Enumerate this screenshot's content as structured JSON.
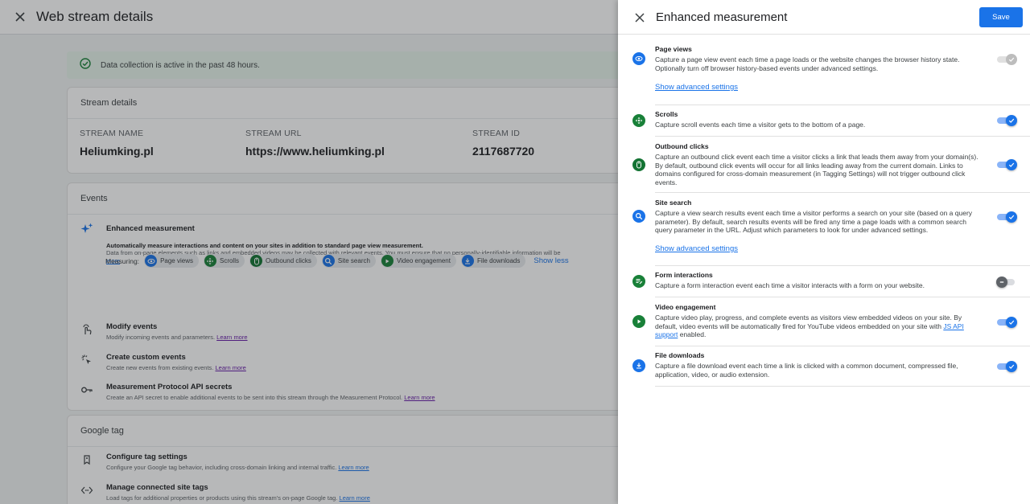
{
  "background": {
    "title": "Web stream details",
    "banner": "Data collection is active in the past 48 hours.",
    "stream_details": {
      "heading": "Stream details",
      "name_label": "STREAM NAME",
      "name_value": "Heliumking.pl",
      "url_label": "STREAM URL",
      "url_value": "https://www.heliumking.pl",
      "id_label": "STREAM ID",
      "id_value": "2117687720"
    },
    "events": {
      "heading": "Events",
      "enhanced_title": "Enhanced measurement",
      "enhanced_desc_1": "Automatically measure interactions and content on your sites in addition to standard page view measurement.",
      "enhanced_desc_2": "Data from on-page elements such as links and embedded videos may be collected with relevant events. You must ensure that no personally-identifiable information will be",
      "enhanced_more": "more",
      "measuring_label": "Measuring:",
      "chips": [
        "Page views",
        "Scrolls",
        "Outbound clicks",
        "Site search",
        "Video engagement",
        "File downloads"
      ],
      "show_less": "Show less",
      "items": [
        {
          "title": "Modify events",
          "desc": "Modify incoming events and parameters.",
          "link": "Learn more"
        },
        {
          "title": "Create custom events",
          "desc": "Create new events from existing events.",
          "link": "Learn more"
        },
        {
          "title": "Measurement Protocol API secrets",
          "desc": "Create an API secret to enable additional events to be sent into this stream through the Measurement Protocol.",
          "link": "Learn more"
        }
      ]
    },
    "google_tag": {
      "heading": "Google tag",
      "items": [
        {
          "title": "Configure tag settings",
          "desc": "Configure your Google tag behavior, including cross-domain linking and internal traffic.",
          "link": "Learn more"
        },
        {
          "title": "Manage connected site tags",
          "desc": "Load tags for additional properties or products using this stream's on-page Google tag.",
          "link": "Learn more"
        }
      ]
    }
  },
  "panel": {
    "title": "Enhanced measurement",
    "save_label": "Save",
    "settings": [
      {
        "title": "Page views",
        "desc": "Capture a page view event each time a page loads or the website changes the browser history state. Optionally turn off browser history-based events under advanced settings.",
        "advanced": "Show advanced settings",
        "state": "disabled-on",
        "icon": "eye-icon"
      },
      {
        "title": "Scrolls",
        "desc": "Capture scroll events each time a visitor gets to the bottom of a page.",
        "state": "on",
        "icon": "scroll-icon"
      },
      {
        "title": "Outbound clicks",
        "desc": "Capture an outbound click event each time a visitor clicks a link that leads them away from your domain(s). By default, outbound click events will occur for all links leading away from the current domain. Links to domains configured for cross-domain measurement (in Tagging Settings) will not trigger outbound click events.",
        "state": "on",
        "icon": "mouse-icon"
      },
      {
        "title": "Site search",
        "desc": "Capture a view search results event each time a visitor performs a search on your site (based on a query parameter). By default, search results events will be fired any time a page loads with a common search query parameter in the URL. Adjust which parameters to look for under advanced settings.",
        "advanced": "Show advanced settings",
        "state": "on",
        "icon": "search-icon"
      },
      {
        "title": "Form interactions",
        "desc": "Capture a form interaction event each time a visitor interacts with a form on your website.",
        "state": "off",
        "icon": "form-icon"
      },
      {
        "title": "Video engagement",
        "desc_before": "Capture video play, progress, and complete events as visitors view embedded videos on your site. By default, video events will be automatically fired for YouTube videos embedded on your site with ",
        "desc_link": "JS API support",
        "desc_after": " enabled.",
        "state": "on",
        "icon": "play-icon"
      },
      {
        "title": "File downloads",
        "desc": "Capture a file download event each time a link is clicked with a common document, compressed file, application, video, or audio extension.",
        "state": "on",
        "icon": "download-icon"
      }
    ]
  }
}
